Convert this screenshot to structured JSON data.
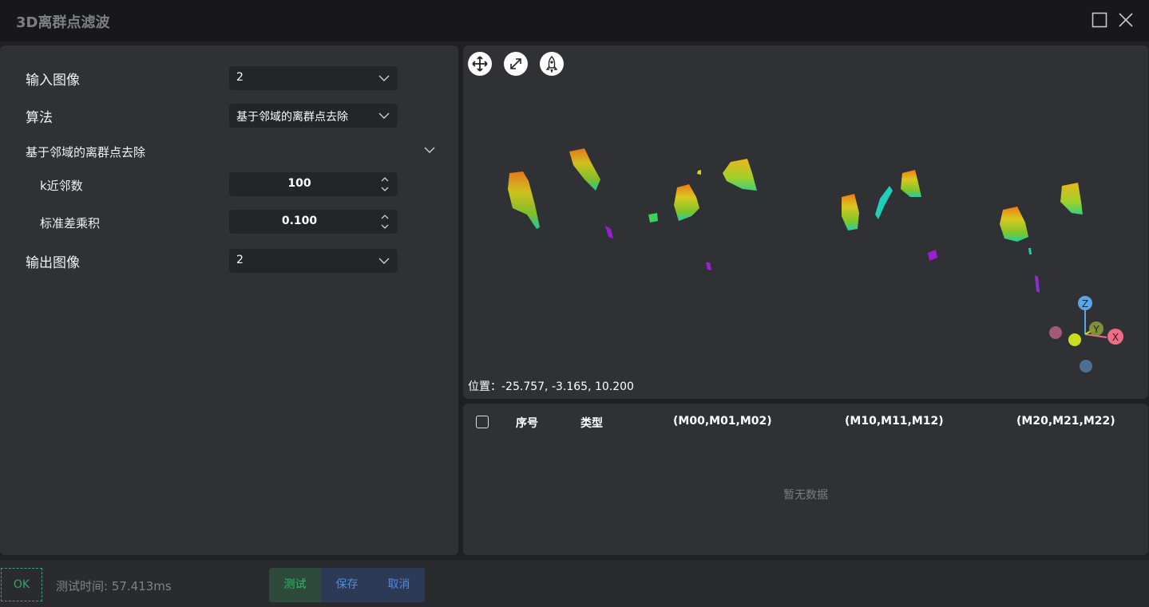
{
  "window": {
    "title": "3D离群点滤波"
  },
  "form": {
    "input_image_label": "输入图像",
    "input_image_value": "2",
    "algorithm_label": "算法",
    "algorithm_value": "基于邻域的离群点去除",
    "section_title": "基于邻域的离群点去除",
    "k_label": "k近邻数",
    "k_value": "100",
    "std_label": "标准差乘积",
    "std_value": "0.100",
    "output_image_label": "输出图像",
    "output_image_value": "2"
  },
  "viewer": {
    "tools": [
      "move-icon",
      "fit-expand-icon",
      "reset-view-icon"
    ],
    "position_label": "位置：",
    "position_value": "-25.757, -3.165, 10.200",
    "axes": {
      "z": "Z",
      "y": "Y",
      "x": "X"
    },
    "colors": {
      "z_axis": "#5aa7e8",
      "x_axis": "#f06b86",
      "y_axis": "#c9de1e"
    }
  },
  "table": {
    "headers": [
      "序号",
      "类型",
      "(M00,M01,M02)",
      "(M10,M11,M12)",
      "(M20,M21,M22)"
    ],
    "empty_text": "暂无数据"
  },
  "footer": {
    "status": "OK",
    "test_time": "测试时间: 57.413ms",
    "test_button": "测试",
    "save_button": "保存",
    "cancel_button": "取消"
  },
  "colors": {
    "accent_green": "#39b66a",
    "accent_blue": "#4a8bea",
    "panel": "#303134"
  }
}
